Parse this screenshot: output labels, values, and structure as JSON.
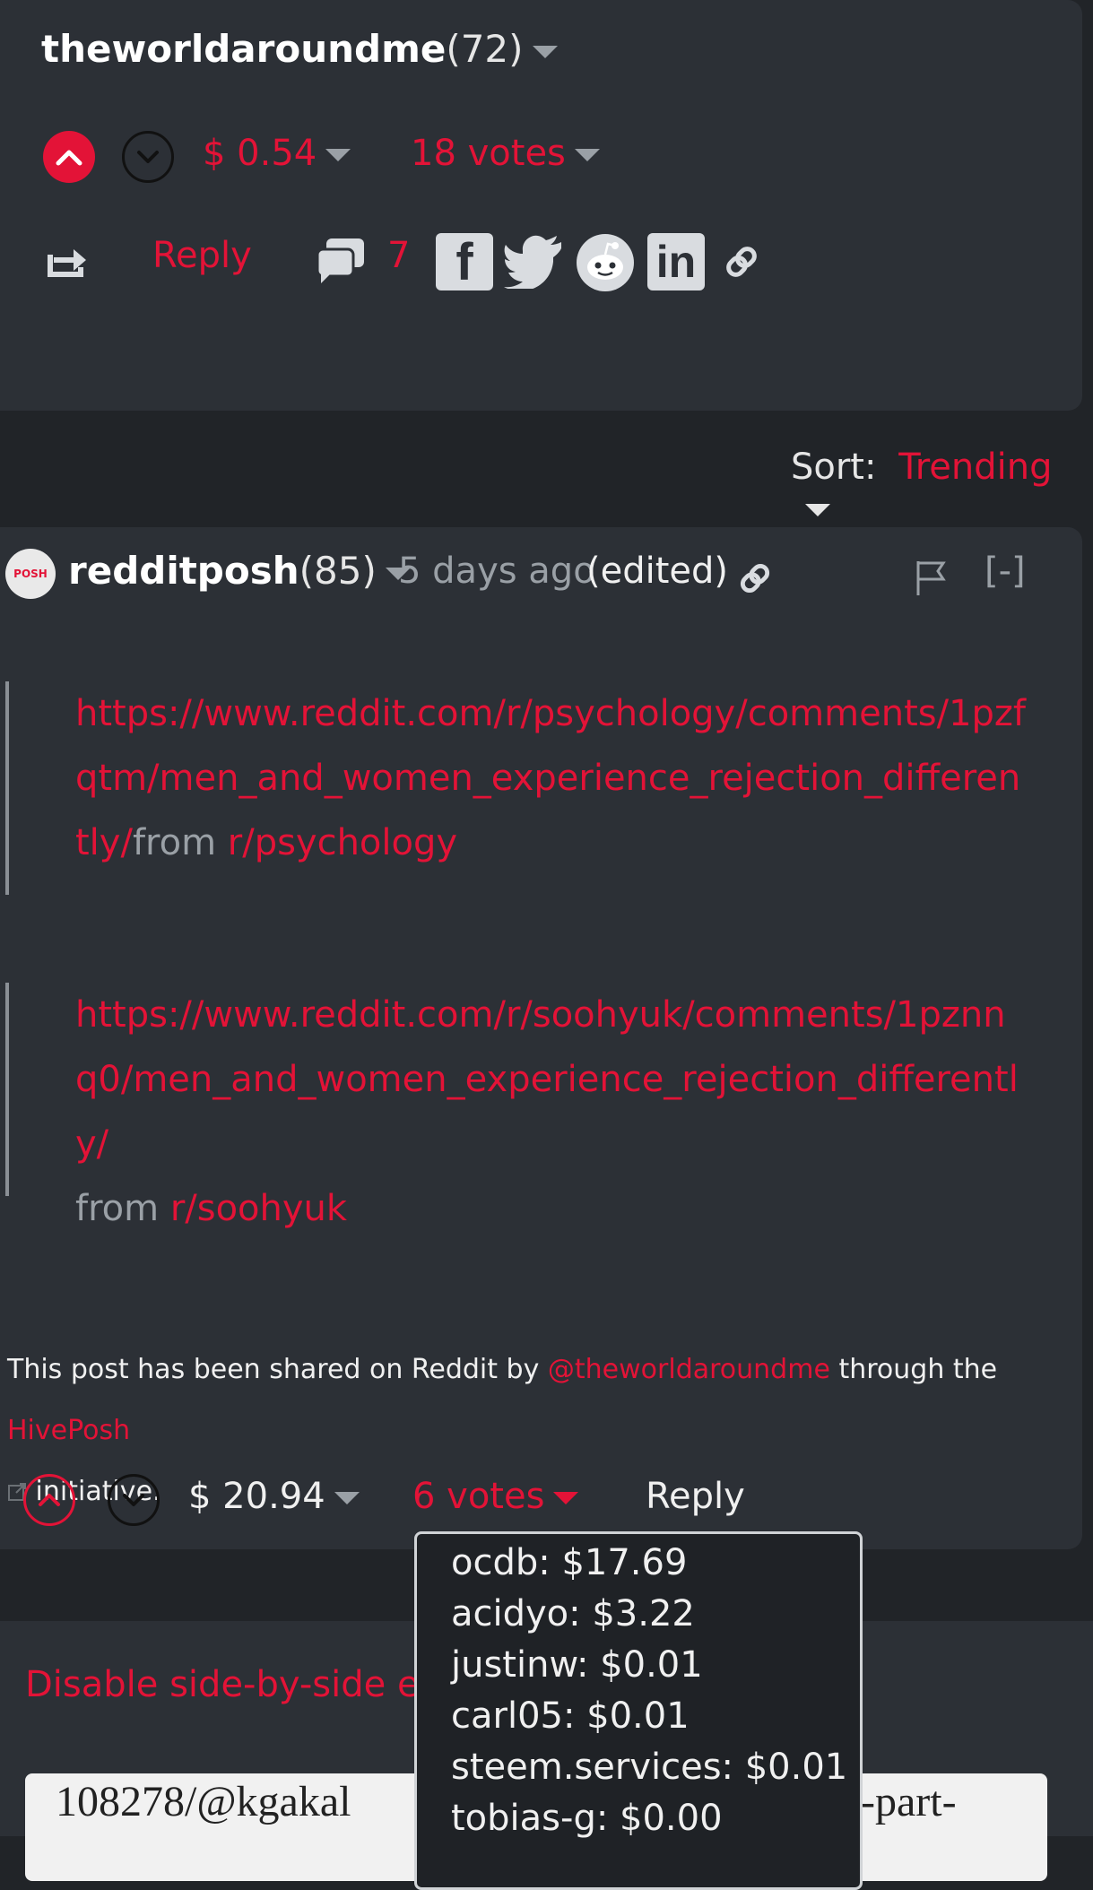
{
  "top_comment": {
    "author": "theworldaroundme",
    "reputation": "(72)",
    "payout": "$ 0.54",
    "votes": "18 votes",
    "reply_label": "Reply",
    "comment_count": "7"
  },
  "sort": {
    "label": "Sort:",
    "value": "Trending"
  },
  "reply_comment": {
    "author": "redditposh",
    "reputation": "(85)",
    "avatar_text": "POSH",
    "timestamp": "5 days ago",
    "edited": "(edited)",
    "collapse_label": "[-]",
    "quote1": {
      "link": "https://www.reddit.com/r/psychology/comments/1pzfqtm/men_and_women_experience_rejection_differently/",
      "from": "from",
      "sub": "r/psychology"
    },
    "quote2": {
      "link": "https://www.reddit.com/r/soohyuk/comments/1pznnq0/men_and_women_experience_rejection_differently/",
      "from": "from",
      "sub": "r/soohyuk"
    },
    "footer": {
      "prefix": "This post has been shared on Reddit by",
      "mention": "@theworldaroundme",
      "middle": "through the",
      "link": "HivePosh",
      "suffix": "initiative."
    },
    "payout": "$ 20.94",
    "votes": "6 votes",
    "reply_label": "Reply"
  },
  "voters_tooltip": [
    "ocdb: $17.69",
    "acidyo: $3.22",
    "justinw: $0.01",
    "carl05: $0.01",
    "steem.services: $0.01",
    "tobias-g: $0.00"
  ],
  "editor": {
    "toggle_label": "Disable side-by-side ed",
    "content_left": "108278/@kgakal",
    "content_right": "-part-"
  },
  "colors": {
    "accent": "#e31337",
    "background": "#212428",
    "card": "#2c3036"
  },
  "icons": [
    "chevron-up-icon",
    "chevron-down-icon",
    "reblog-icon",
    "comments-icon",
    "facebook-icon",
    "twitter-icon",
    "reddit-icon",
    "linkedin-icon",
    "link-icon",
    "flag-icon",
    "external-link-icon"
  ]
}
